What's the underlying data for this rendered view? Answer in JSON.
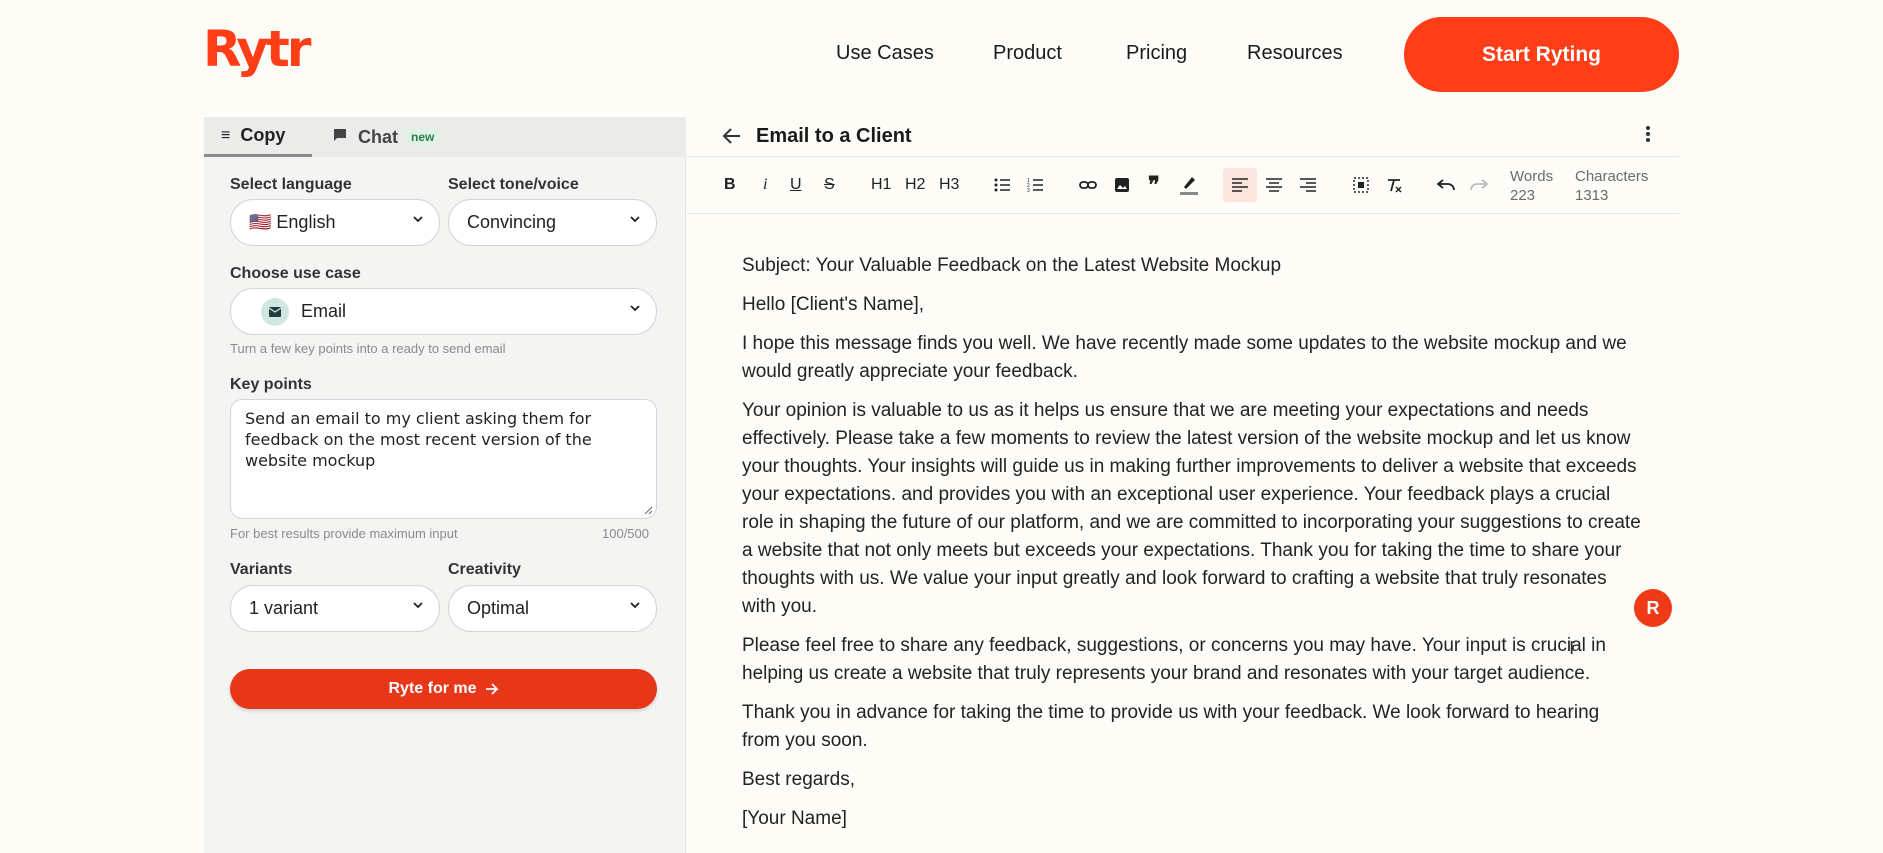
{
  "brand": {
    "logo_text": "Rytr",
    "color": "#ff3d17"
  },
  "nav": {
    "items": [
      "Use Cases",
      "Product",
      "Pricing",
      "Resources"
    ],
    "cta": "Start Ryting"
  },
  "left": {
    "tabs": {
      "copy": "Copy",
      "chat": "Chat",
      "chat_badge": "new"
    },
    "language_label": "Select language",
    "language_value": "🇺🇸 English",
    "tone_label": "Select tone/voice",
    "tone_value": "Convincing",
    "usecase_label": "Choose use case",
    "usecase_value": "Email",
    "usecase_hint": "Turn a few key points into a ready to send email",
    "keypoints_label": "Key points",
    "keypoints_value": "Send an email to my client asking them for feedback on the most recent version of the website mockup",
    "keypoints_hint": "For best results provide maximum input",
    "keypoints_count": "100/500",
    "variants_label": "Variants",
    "variants_value": "1 variant",
    "creativity_label": "Creativity",
    "creativity_value": "Optimal",
    "ryte_button": "Ryte for me"
  },
  "editor": {
    "title": "Email to a Client",
    "toolbar": {
      "bold": "B",
      "italic": "i",
      "underline": "U",
      "strike": "S",
      "h1": "H1",
      "h2": "H2",
      "h3": "H3"
    },
    "words_label": "Words",
    "words_value": "223",
    "chars_label": "Characters",
    "chars_value": "1313",
    "paragraphs": [
      "Subject: Your Valuable Feedback on the Latest Website Mockup",
      "Hello [Client's Name],",
      "I hope this message finds you well. We have recently made some updates to the website mockup and we would greatly appreciate your feedback.",
      "Your opinion is valuable to us as it helps us ensure that we are meeting your expectations and needs effectively. Please take a few moments to review the latest version of the website mockup and let us know your thoughts. Your insights will guide us in making further improvements to deliver a website that exceeds your expectations. and provides you with an exceptional user experience. Your feedback plays a crucial role in shaping the future of our platform, and we are committed to incorporating your suggestions to create a website that not only meets but exceeds your expectations. Thank you for taking the time to share your thoughts with us. We value your input greatly and look forward to crafting a website that truly resonates with you.",
      "Please feel free to share any feedback, suggestions, or concerns you may have. Your input is crucial in helping us create a website that truly represents your brand and resonates with your target audience.",
      "Thank you in advance for taking the time to provide us with your feedback. We look forward to hearing from you soon.",
      "Best regards,",
      "[Your Name]"
    ],
    "fab_letter": "R"
  }
}
